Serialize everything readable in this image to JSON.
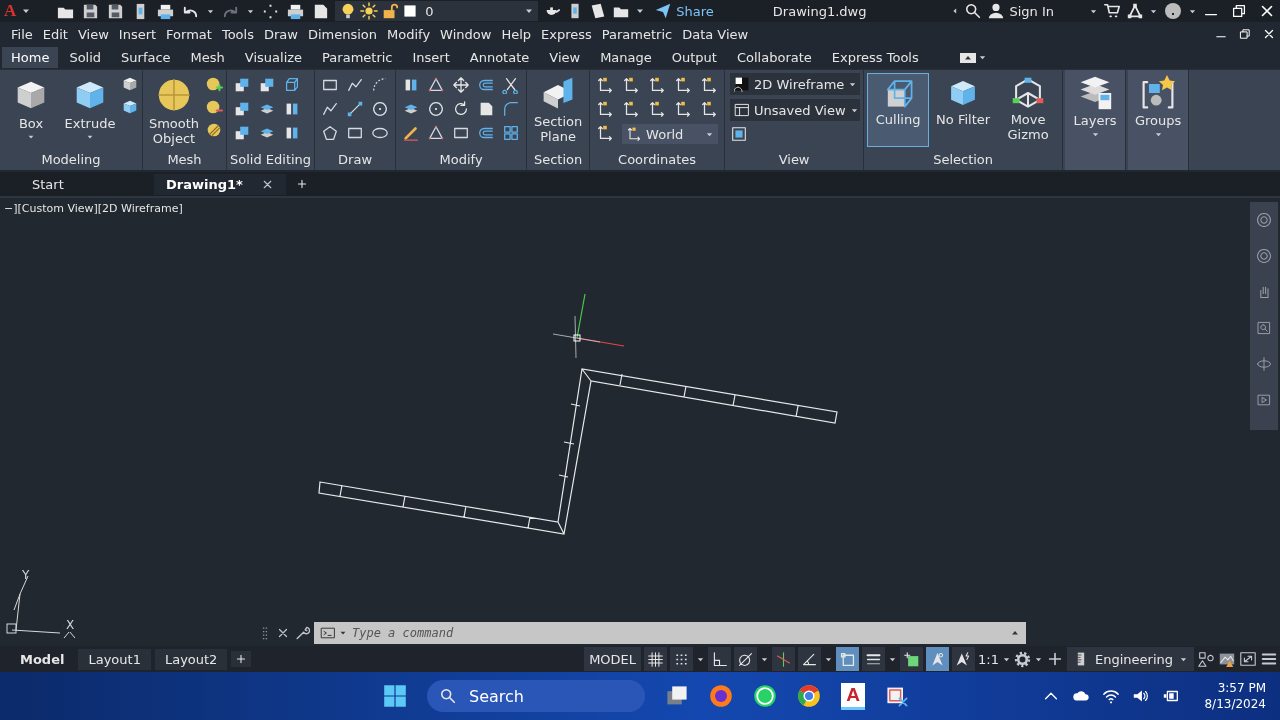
{
  "title_bar": {
    "logo": "A",
    "layer": "0",
    "share": "Share",
    "title": "Drawing1.dwg",
    "sign_in": "Sign In"
  },
  "menu": [
    "File",
    "Edit",
    "View",
    "Insert",
    "Format",
    "Tools",
    "Draw",
    "Dimension",
    "Modify",
    "Window",
    "Help",
    "Express",
    "Parametric",
    "Data View"
  ],
  "ribbon_tabs": [
    {
      "label": "Home",
      "selected": true
    },
    {
      "label": "Solid",
      "selected": false
    },
    {
      "label": "Surface",
      "selected": false
    },
    {
      "label": "Mesh",
      "selected": false
    },
    {
      "label": "Visualize",
      "selected": false
    },
    {
      "label": "Parametric",
      "selected": false
    },
    {
      "label": "Insert",
      "selected": false
    },
    {
      "label": "Annotate",
      "selected": false
    },
    {
      "label": "View",
      "selected": false
    },
    {
      "label": "Manage",
      "selected": false
    },
    {
      "label": "Output",
      "selected": false
    },
    {
      "label": "Collaborate",
      "selected": false
    },
    {
      "label": "Express Tools",
      "selected": false
    }
  ],
  "panels": {
    "modeling": {
      "title": "Modeling",
      "buttons": [
        "Box",
        "Extrude"
      ]
    },
    "mesh": {
      "title": "Mesh",
      "buttons": [
        "Smooth Object"
      ]
    },
    "solid_editing": {
      "title": "Solid Editing"
    },
    "draw": {
      "title": "Draw"
    },
    "modify": {
      "title": "Modify"
    },
    "section": {
      "title": "Section",
      "buttons": [
        "Section Plane"
      ]
    },
    "coordinates": {
      "title": "Coordinates",
      "ucs": "World"
    },
    "view": {
      "title": "View",
      "visual_style": "2D Wireframe",
      "named_view": "Unsaved View"
    },
    "selection": {
      "title": "Selection",
      "buttons": [
        {
          "label": "Culling",
          "on": true
        },
        {
          "label": "No Filter",
          "on": false
        },
        {
          "label": "Move Gizmo",
          "on": false
        }
      ]
    },
    "layers": {
      "title": "Layers"
    },
    "groups": {
      "title": "Groups"
    }
  },
  "file_tabs": [
    {
      "label": "Start",
      "selected": false
    },
    {
      "label": "Drawing1*",
      "selected": true
    }
  ],
  "viewport_label": "−][Custom View][2D Wireframe]",
  "ucs_labels": {
    "x": "X",
    "y": "Y"
  },
  "command_line": {
    "placeholder": "Type a command"
  },
  "layout_tabs": [
    {
      "label": "Model",
      "selected": true
    },
    {
      "label": "Layout1",
      "selected": false
    },
    {
      "label": "Layout2",
      "selected": false
    }
  ],
  "status_bar": {
    "space": "MODEL",
    "scale": "1:1",
    "units": "Engineering",
    "toggles": [
      {
        "on": false
      },
      {
        "on": false
      },
      {
        "on": false
      },
      {
        "on": false
      },
      {
        "on": false
      },
      {
        "on": false
      },
      {
        "on": true
      },
      {
        "on": false
      },
      {
        "on": false
      },
      {
        "on": true
      },
      {
        "on": false
      }
    ]
  },
  "taskbar": {
    "search": "Search",
    "app_logo": "A",
    "time": "3:57 PM",
    "date": "8/13/2024"
  }
}
